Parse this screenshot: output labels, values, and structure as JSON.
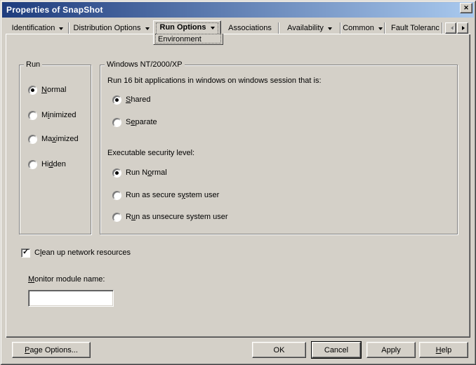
{
  "window": {
    "title": "Properties of SnapShot",
    "close_glyph": "✕"
  },
  "tabs": [
    {
      "label": "Identification",
      "dropdown": true,
      "active": false
    },
    {
      "label": "Distribution Options",
      "dropdown": true,
      "active": false
    },
    {
      "label": "Run Options",
      "dropdown": true,
      "active": true
    },
    {
      "label": "Associations",
      "dropdown": false,
      "active": false
    },
    {
      "label": "Availability",
      "dropdown": true,
      "active": false
    },
    {
      "label": "Common",
      "dropdown": true,
      "active": false
    },
    {
      "label": "Fault Toleranc",
      "dropdown": false,
      "active": false
    }
  ],
  "subtab": {
    "label": "Environment"
  },
  "tab_scroll": {
    "left_enabled": false,
    "right_enabled": true
  },
  "run_group": {
    "title": "Run",
    "options": [
      {
        "pre": "",
        "u": "N",
        "post": "ormal",
        "selected": true
      },
      {
        "pre": "M",
        "u": "i",
        "post": "nimized",
        "selected": false
      },
      {
        "pre": "Ma",
        "u": "x",
        "post": "imized",
        "selected": false
      },
      {
        "pre": "Hi",
        "u": "d",
        "post": "den",
        "selected": false
      }
    ]
  },
  "nt_group": {
    "title": "Windows NT/2000/XP",
    "question1": "Run 16 bit applications in windows on windows session that is:",
    "session_options": [
      {
        "pre": "",
        "u": "S",
        "post": "hared",
        "selected": true
      },
      {
        "pre": "S",
        "u": "e",
        "post": "parate",
        "selected": false
      }
    ],
    "question2": "Executable security level:",
    "security_options": [
      {
        "pre": "Run N",
        "u": "o",
        "post": "rmal",
        "selected": true
      },
      {
        "pre": "Run as secure s",
        "u": "y",
        "post": "stem user",
        "selected": false
      },
      {
        "pre": "R",
        "u": "u",
        "post": "n as unsecure system user",
        "selected": false
      }
    ]
  },
  "cleanup_checkbox": {
    "pre": "C",
    "u": "l",
    "post": "ean up network resources",
    "checked": true
  },
  "monitor": {
    "label_pre": "",
    "label_u": "M",
    "label_post": "onitor module name:",
    "input_value": ""
  },
  "buttons": {
    "page_options": {
      "pre": "",
      "u": "P",
      "post": "age Options..."
    },
    "ok": "OK",
    "cancel": "Cancel",
    "apply": "Apply",
    "help": {
      "pre": "",
      "u": "H",
      "post": "elp"
    }
  }
}
